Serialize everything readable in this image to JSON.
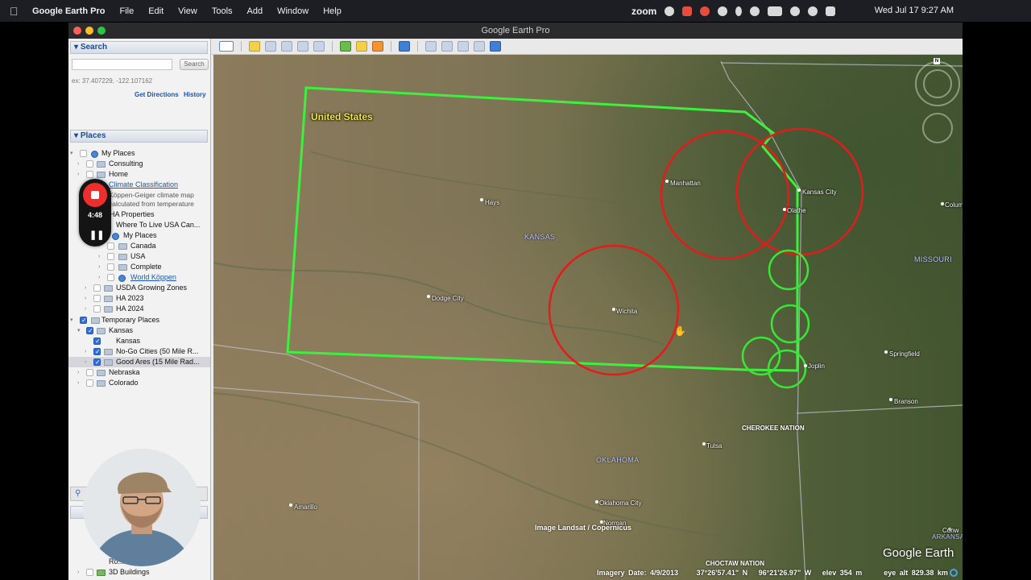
{
  "menubar": {
    "app_name": "Google Earth Pro",
    "items": [
      "File",
      "Edit",
      "View",
      "Tools",
      "Add",
      "Window",
      "Help"
    ],
    "zoom_label": "zoom",
    "datetime": "Wed Jul 17  9:27 AM"
  },
  "window": {
    "title": "Google Earth Pro"
  },
  "search": {
    "header": "Search",
    "button_label": "Search",
    "hint": "ex: 37.407229, -122.107162",
    "get_directions": "Get Directions",
    "history": "History"
  },
  "places": {
    "header": "Places",
    "items": [
      {
        "label": "My Places",
        "icon": "globe-icon"
      },
      {
        "label": "Consulting",
        "icon": "folder-icon"
      },
      {
        "label": "Home",
        "icon": "folder-icon"
      },
      {
        "label": "Climate Classification",
        "icon": "link-icon"
      },
      {
        "label": "Köppen-Geiger climate map",
        "icon": ""
      },
      {
        "label": "calculated from temperature",
        "icon": ""
      },
      {
        "label": "HA Properties",
        "icon": "folder-icon"
      },
      {
        "label": "Where To Live USA Can...",
        "icon": "folder-icon"
      },
      {
        "label": "My Places",
        "icon": "globe-icon"
      },
      {
        "label": "Canada",
        "icon": "folder-icon"
      },
      {
        "label": "USA",
        "icon": "folder-icon"
      },
      {
        "label": "Complete",
        "icon": "folder-icon"
      },
      {
        "label": "World Köppen",
        "icon": "globe-icon"
      },
      {
        "label": "USDA Growing Zones",
        "icon": "folder-icon"
      },
      {
        "label": "HA 2023",
        "icon": "folder-icon"
      },
      {
        "label": "HA 2024",
        "icon": "folder-icon"
      },
      {
        "label": "Temporary Places",
        "icon": "folder-icon"
      },
      {
        "label": "Kansas",
        "icon": "folder-icon"
      },
      {
        "label": "Kansas",
        "icon": "path-icon"
      },
      {
        "label": "No-Go Cities (50 Mile R...",
        "icon": "folder-icon"
      },
      {
        "label": "Good Ares (15 Mile Rad...",
        "icon": "folder-icon"
      },
      {
        "label": "Nebraska",
        "icon": "folder-icon"
      },
      {
        "label": "Colorado",
        "icon": "folder-icon"
      }
    ],
    "layers_bottom": [
      "Ro...",
      "3D Buildings"
    ]
  },
  "recorder": {
    "time": "4:48"
  },
  "map": {
    "country_label": "United States",
    "states": [
      "KANSAS",
      "MISSOURI",
      "OKLAHOMA"
    ],
    "cities": [
      "Manhattan",
      "Kansas City",
      "Olathe",
      "Hays",
      "Dodge City",
      "Wichita",
      "Joplin",
      "Springfield",
      "Branson",
      "Tulsa",
      "Oklahoma City",
      "Norman",
      "Amarillo",
      "Colum",
      "Conw"
    ],
    "nations": [
      "CHEROKEE NATION",
      "CHOCTAW NATION"
    ],
    "small_labels": [
      "ARKANSAS"
    ],
    "attribution": "Image Landsat / Copernicus",
    "status": {
      "imagery_date": "Imagery Date: 4/9/2013",
      "lat": "37°26'57.41\" N",
      "lon": "96°21'26.97\" W",
      "elev": "elev  354 m",
      "eye_alt": "eye alt 829.38 km"
    },
    "logo": "Google Earth",
    "colors": {
      "boundary": "#3df03d",
      "no_go": "#e41b1b",
      "good_area": "#39e635"
    }
  }
}
